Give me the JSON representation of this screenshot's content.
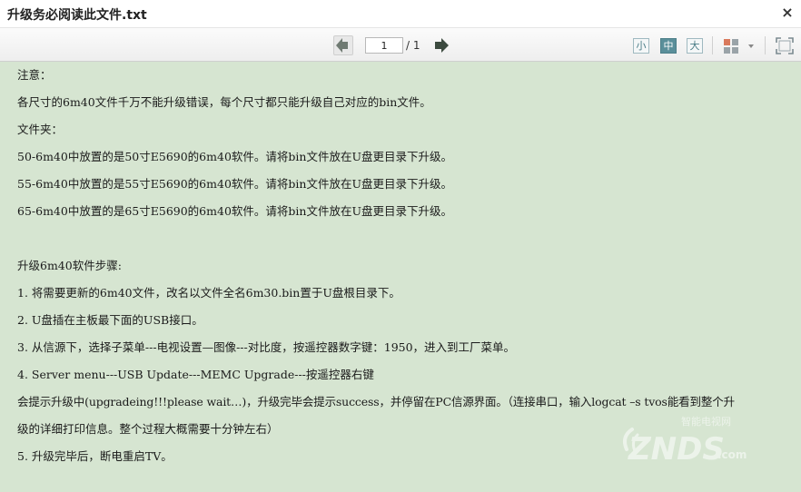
{
  "window": {
    "title": "升级务必阅读此文件.txt",
    "close_glyph": "×"
  },
  "toolbar": {
    "page_current": "1",
    "page_total": "/ 1",
    "size_small": "小",
    "size_medium": "中",
    "size_large": "大"
  },
  "document": {
    "lines": [
      "注意：",
      "各尺寸的6m40文件千万不能升级错误，每个尺寸都只能升级自己对应的bin文件。",
      "文件夹：",
      "50-6m40中放置的是50寸E5690的6m40软件。请将bin文件放在U盘更目录下升级。",
      "55-6m40中放置的是55寸E5690的6m40软件。请将bin文件放在U盘更目录下升级。",
      "65-6m40中放置的是65寸E5690的6m40软件。请将bin文件放在U盘更目录下升级。",
      "",
      "升级6m40软件步骤:",
      "1.   将需要更新的6m40文件，改名以文件全名6m30.bin置于U盘根目录下。",
      "2.   U盘插在主板最下面的USB接口。",
      "3.   从信源下，选择子菜单---电视设置—图像---对比度，按遥控器数字键：1950，进入到工厂菜单。",
      "4.   Server menu---USB Update---MEMC Upgrade---按遥控器右键",
      "会提示升级中(upgradeing!!!please wait…)，升级完毕会提示success，并停留在PC信源界面。（连接串口，输入logcat –s tvos能看到整个升",
      "级的详细打印信息。整个过程大概需要十分钟左右）",
      "5.   升级完毕后，断电重启TV。"
    ]
  },
  "watermark": {
    "top_text": "智能电视网",
    "main_text": "ZNDS",
    "suffix": ".com"
  },
  "colors": {
    "content_bg": "#d6e5d1",
    "nav_arrow": "#3c4a3f",
    "accent": "#5a8f9a"
  }
}
